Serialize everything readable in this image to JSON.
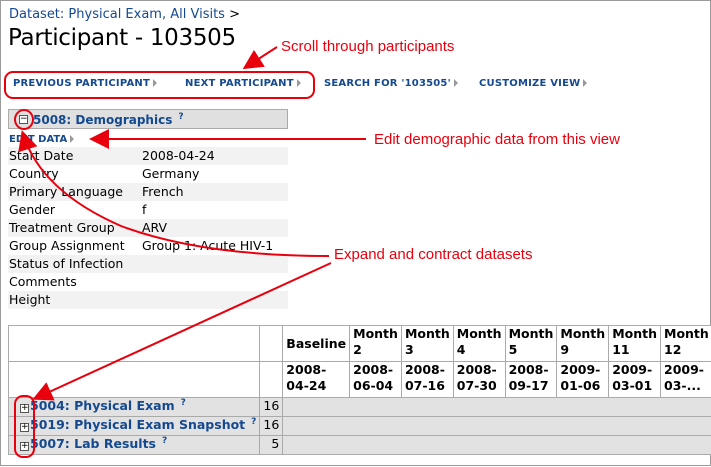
{
  "breadcrumb": {
    "link": "Dataset: Physical Exam, All Visits",
    "sep": ">"
  },
  "page_title": "Participant - 103505",
  "nav": {
    "previous": "PREVIOUS PARTICIPANT",
    "next": "NEXT PARTICIPANT",
    "search": "SEARCH FOR '103505'",
    "customize": "CUSTOMIZE VIEW"
  },
  "annotations": {
    "scroll": "Scroll through participants",
    "edit": "Edit demographic data from this view",
    "expand": "Expand and contract datasets",
    "color": "#e8000d"
  },
  "demographics": {
    "toggle_symbol": "−",
    "title": "5008: Demographics",
    "help": "?",
    "edit_label": "EDIT DATA",
    "fields": [
      {
        "label": "Start Date",
        "value": "2008-04-24"
      },
      {
        "label": "Country",
        "value": "Germany"
      },
      {
        "label": "Primary Language",
        "value": "French"
      },
      {
        "label": "Gender",
        "value": "f"
      },
      {
        "label": "Treatment Group",
        "value": "ARV"
      },
      {
        "label": "Group Assignment",
        "value": "Group 1: Acute HIV-1"
      },
      {
        "label": "Status of Infection",
        "value": ""
      },
      {
        "label": "Comments",
        "value": ""
      },
      {
        "label": "Height",
        "value": ""
      }
    ]
  },
  "visits": {
    "columns": [
      {
        "name": "Baseline",
        "date": "2008-04-24"
      },
      {
        "name": "Month 2",
        "date": "2008-06-04"
      },
      {
        "name": "Month 3",
        "date": "2008-07-16"
      },
      {
        "name": "Month 4",
        "date": "2008-07-30"
      },
      {
        "name": "Month 5",
        "date": "2008-09-17"
      },
      {
        "name": "Month 9",
        "date": "2009-01-06"
      },
      {
        "name": "Month 11",
        "date": "2009-03-01"
      },
      {
        "name": "Month 12",
        "date": "2009-03-..."
      }
    ],
    "datasets": [
      {
        "toggle": "+",
        "name": "5004: Physical Exam",
        "help": "?",
        "count": "16"
      },
      {
        "toggle": "+",
        "name": "5019: Physical Exam Snapshot",
        "help": "?",
        "count": "16"
      },
      {
        "toggle": "+",
        "name": "5007: Lab Results",
        "help": "?",
        "count": "5"
      }
    ]
  }
}
